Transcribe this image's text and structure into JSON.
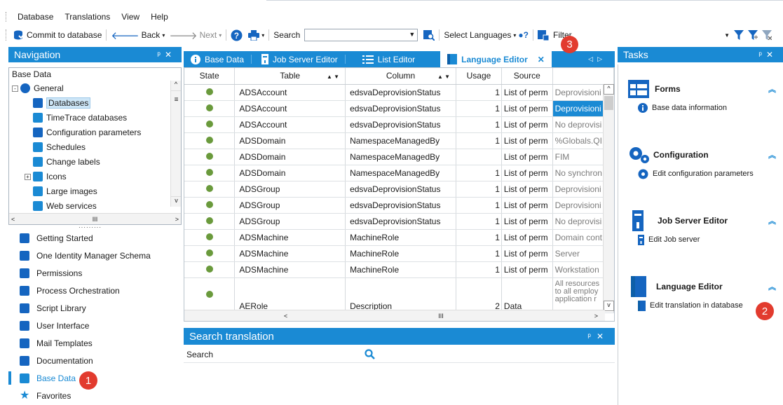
{
  "menu": [
    "Database",
    "Translations",
    "View",
    "Help"
  ],
  "toolbar": {
    "commit": "Commit to database",
    "back": "Back",
    "next": "Next",
    "search_label": "Search",
    "select_languages": "Select Languages",
    "filter": "Filter"
  },
  "nav": {
    "title": "Navigation",
    "tree_root": "Base Data",
    "tree": [
      {
        "label": "General",
        "level": 0,
        "expander": "−"
      },
      {
        "label": "Databases",
        "level": 1,
        "selected": true
      },
      {
        "label": "TimeTrace databases",
        "level": 1
      },
      {
        "label": "Configuration parameters",
        "level": 1
      },
      {
        "label": "Schedules",
        "level": 1
      },
      {
        "label": "Change labels",
        "level": 1
      },
      {
        "label": "Icons",
        "level": 1,
        "expander": "+"
      },
      {
        "label": "Large images",
        "level": 1
      },
      {
        "label": "Web services",
        "level": 1
      }
    ],
    "scroll_mid": "III",
    "items": [
      {
        "label": "Getting Started",
        "icon": "checklist-icon"
      },
      {
        "label": "One Identity Manager Schema",
        "icon": "schema-icon"
      },
      {
        "label": "Permissions",
        "icon": "permissions-icon"
      },
      {
        "label": "Process Orchestration",
        "icon": "process-icon"
      },
      {
        "label": "Script Library",
        "icon": "script-icon"
      },
      {
        "label": "User Interface",
        "icon": "user-interface-icon"
      },
      {
        "label": "Mail Templates",
        "icon": "mail-icon"
      },
      {
        "label": "Documentation",
        "icon": "documentation-icon"
      },
      {
        "label": "Base Data",
        "icon": "base-data-icon",
        "active": true
      },
      {
        "label": "Favorites",
        "icon": "star-icon"
      }
    ]
  },
  "tabs": [
    {
      "label": "Base Data"
    },
    {
      "label": "Job Server Editor"
    },
    {
      "label": "List Editor"
    },
    {
      "label": "Language Editor",
      "active": true
    }
  ],
  "grid": {
    "columns": [
      "State",
      "Table",
      "Column",
      "Usage",
      "Source",
      ""
    ],
    "rows": [
      {
        "table": "ADSAccount",
        "column": "edsvaDeprovisionStatus",
        "usage": "1",
        "source": "List of perm",
        "text": "Deprovisioni"
      },
      {
        "table": "ADSAccount",
        "column": "edsvaDeprovisionStatus",
        "usage": "1",
        "source": "List of perm",
        "text": "Deprovisioni",
        "highlight": true
      },
      {
        "table": "ADSAccount",
        "column": "edsvaDeprovisionStatus",
        "usage": "1",
        "source": "List of perm",
        "text": "No deprovisi"
      },
      {
        "table": "ADSDomain",
        "column": "NamespaceManagedBy",
        "usage": "1",
        "source": "List of perm",
        "text": "%Globals.QIM"
      },
      {
        "table": "ADSDomain",
        "column": "NamespaceManagedBy",
        "usage": "",
        "source": "List of perm",
        "text": "FIM"
      },
      {
        "table": "ADSDomain",
        "column": "NamespaceManagedBy",
        "usage": "1",
        "source": "List of perm",
        "text": "No synchron"
      },
      {
        "table": "ADSGroup",
        "column": "edsvaDeprovisionStatus",
        "usage": "1",
        "source": "List of perm",
        "text": "Deprovisioni"
      },
      {
        "table": "ADSGroup",
        "column": "edsvaDeprovisionStatus",
        "usage": "1",
        "source": "List of perm",
        "text": "Deprovisioni"
      },
      {
        "table": "ADSGroup",
        "column": "edsvaDeprovisionStatus",
        "usage": "1",
        "source": "List of perm",
        "text": "No deprovisi"
      },
      {
        "table": "ADSMachine",
        "column": "MachineRole",
        "usage": "1",
        "source": "List of perm",
        "text": "Domain cont"
      },
      {
        "table": "ADSMachine",
        "column": "MachineRole",
        "usage": "1",
        "source": "List of perm",
        "text": "Server"
      },
      {
        "table": "ADSMachine",
        "column": "MachineRole",
        "usage": "1",
        "source": "List of perm",
        "text": "Workstation"
      }
    ],
    "tall_row": {
      "table": "AERole",
      "column": "Description",
      "usage": "2",
      "source": "Data",
      "lines": [
        "All resources",
        "to all employ",
        "application r"
      ]
    },
    "scroll_mid": "III"
  },
  "search_translation": {
    "title": "Search translation",
    "label": "Search"
  },
  "tasks": {
    "title": "Tasks",
    "sections": [
      {
        "title": "Forms",
        "item": "Base data information"
      },
      {
        "title": "Configuration",
        "item": "Edit configuration parameters"
      },
      {
        "title": "Job Server Editor",
        "item": "Edit Job server"
      },
      {
        "title": "Language Editor",
        "item": "Edit translation in database"
      }
    ]
  },
  "badges": [
    "1",
    "2",
    "3"
  ],
  "colors": {
    "accent": "#1a8ad4",
    "badge": "#e23b2e",
    "state_dot": "#6a9a3c"
  }
}
